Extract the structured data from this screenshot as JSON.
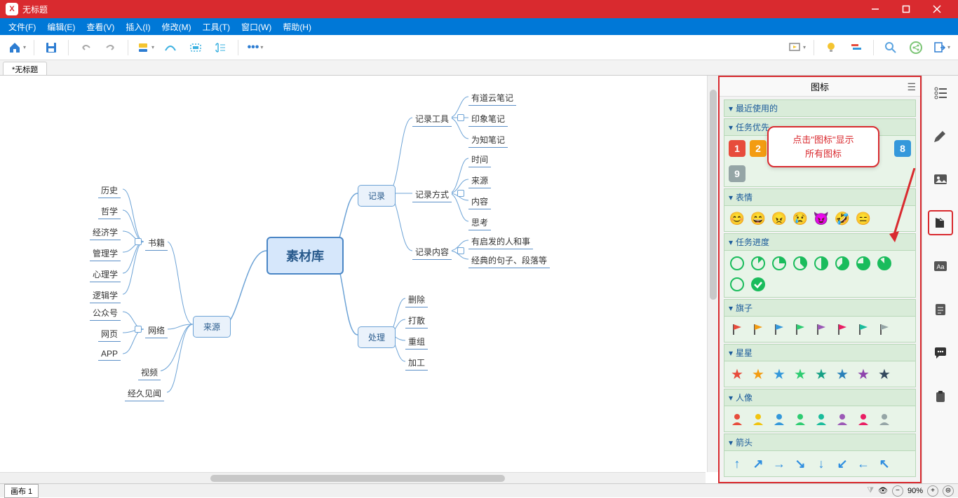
{
  "title": "无标题",
  "menus": [
    "文件(F)",
    "编辑(E)",
    "查看(V)",
    "插入(I)",
    "修改(M)",
    "工具(T)",
    "窗口(W)",
    "帮助(H)"
  ],
  "tab": "*无标题",
  "sheet": "画布 1",
  "zoom": "90%",
  "mindmap": {
    "central": "素材库",
    "left_main": [
      {
        "label": "书籍",
        "children": [
          "历史",
          "哲学",
          "经济学",
          "管理学",
          "心理学",
          "逻辑学"
        ]
      },
      {
        "label": "网络",
        "children": [
          "公众号",
          "网页",
          "APP"
        ]
      },
      {
        "label": "视频",
        "children": []
      },
      {
        "label": "经久见闻",
        "children": []
      }
    ],
    "left_group": "来源",
    "right_main": [
      {
        "label": "记录",
        "children": [
          {
            "label": "记录工具",
            "children": [
              "有道云笔记",
              "印象笔记",
              "为知笔记"
            ]
          },
          {
            "label": "记录方式",
            "children": [
              "时间",
              "来源",
              "内容",
              "思考"
            ]
          },
          {
            "label": "记录内容",
            "children": [
              "有启发的人和事",
              "经典的句子、段落等"
            ]
          }
        ]
      },
      {
        "label": "处理",
        "children": [
          {
            "label": "删除"
          },
          {
            "label": "打散"
          },
          {
            "label": "重组"
          },
          {
            "label": "加工"
          }
        ]
      }
    ]
  },
  "panel": {
    "title": "图标",
    "sections": {
      "recent": "最近使用的",
      "priority": "任务优先",
      "emotion": "表情",
      "progress": "任务进度",
      "flags": "旗子",
      "stars": "星星",
      "people": "人像",
      "arrows": "箭头"
    },
    "priority_nums": [
      "1",
      "2",
      "8",
      "9"
    ],
    "emotions": [
      "😊",
      "😄",
      "😠",
      "😢",
      "😈",
      "🤣",
      "😑"
    ],
    "flag_colors": [
      "#e74c3c",
      "#f39c12",
      "#3498db",
      "#2ecc71",
      "#9b59b6",
      "#e91e63",
      "#1abc9c",
      "#95a5a6"
    ],
    "star_colors": [
      "#e74c3c",
      "#f39c12",
      "#3498db",
      "#2ecc71",
      "#16a085",
      "#2980b9",
      "#8e44ad",
      "#34495e"
    ],
    "people_colors": [
      "#e74c3c",
      "#f1c40f",
      "#3498db",
      "#2ecc71",
      "#1abc9c",
      "#9b59b6",
      "#e91e63",
      "#95a5a6"
    ],
    "arrow_glyphs": [
      "↑",
      "↗",
      "→",
      "↘",
      "↓",
      "↙",
      "←",
      "↖"
    ]
  },
  "callout": "点击\"图标\"显示\n所有图标"
}
